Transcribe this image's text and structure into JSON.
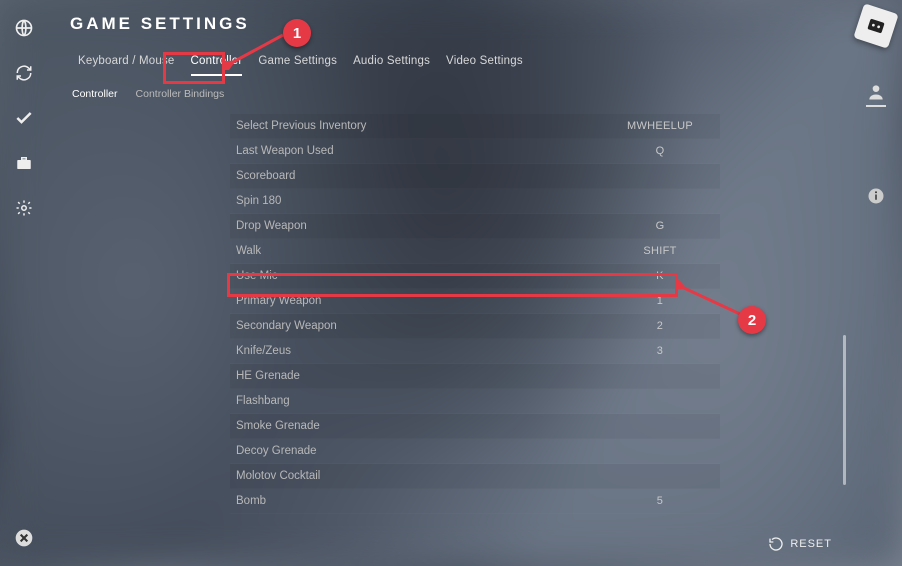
{
  "title": "GAME SETTINGS",
  "tabs": [
    {
      "label": "Keyboard / Mouse",
      "active": false
    },
    {
      "label": "Controller",
      "active": true
    },
    {
      "label": "Game Settings",
      "active": false
    },
    {
      "label": "Audio Settings",
      "active": false
    },
    {
      "label": "Video Settings",
      "active": false
    }
  ],
  "subtabs": [
    {
      "label": "Controller",
      "active": true
    },
    {
      "label": "Controller Bindings",
      "active": false
    }
  ],
  "bindings": [
    {
      "label": "Select Previous Inventory",
      "key": "MWHEELUP"
    },
    {
      "label": "Last Weapon Used",
      "key": "Q"
    },
    {
      "label": "Scoreboard",
      "key": ""
    },
    {
      "label": "Spin 180",
      "key": ""
    },
    {
      "label": "Drop Weapon",
      "key": "G"
    },
    {
      "label": "Walk",
      "key": "SHIFT"
    },
    {
      "label": "Use Mic",
      "key": "K"
    },
    {
      "label": "Primary Weapon",
      "key": "1"
    },
    {
      "label": "Secondary Weapon",
      "key": "2"
    },
    {
      "label": "Knife/Zeus",
      "key": "3"
    },
    {
      "label": "HE Grenade",
      "key": ""
    },
    {
      "label": "Flashbang",
      "key": ""
    },
    {
      "label": "Smoke Grenade",
      "key": ""
    },
    {
      "label": "Decoy Grenade",
      "key": ""
    },
    {
      "label": "Molotov Cocktail",
      "key": ""
    },
    {
      "label": "Bomb",
      "key": "5"
    }
  ],
  "reset_label": "RESET",
  "annotations": {
    "one": "1",
    "two": "2"
  }
}
